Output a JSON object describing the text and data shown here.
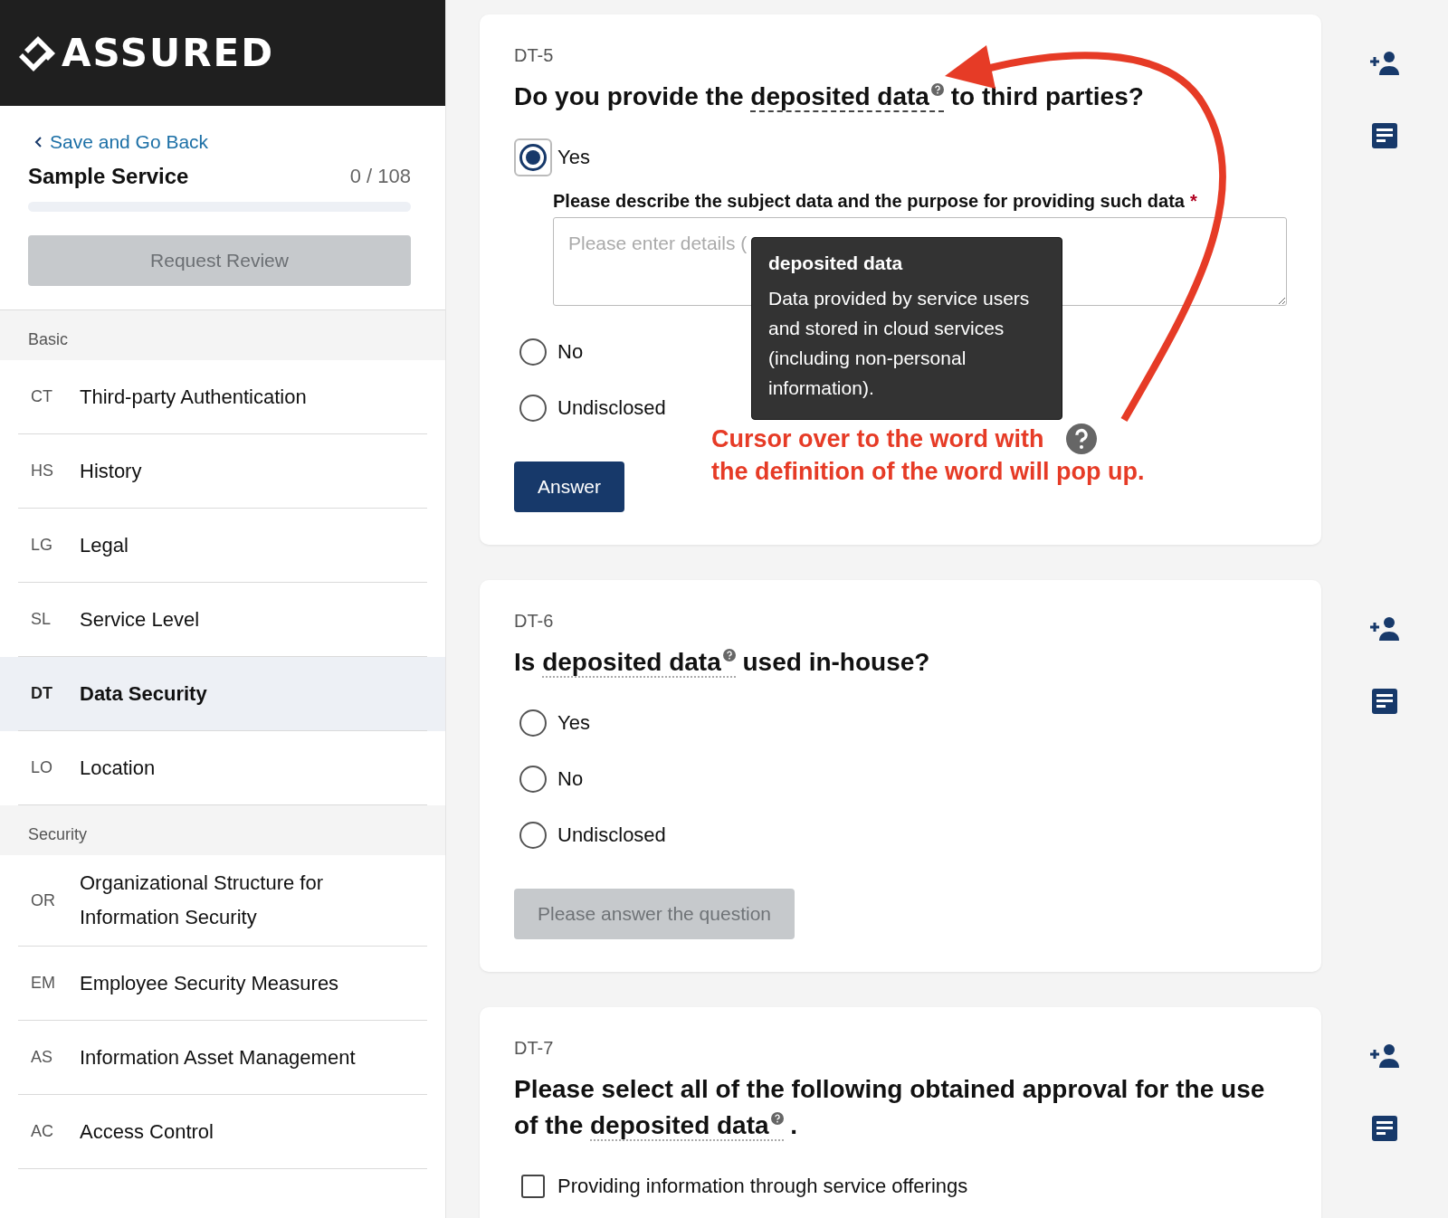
{
  "header": {
    "logo": "ASSURED"
  },
  "sidebar": {
    "back_link": "Save and Go Back",
    "service": "Sample Service",
    "count": "0 / 108",
    "progress": {
      "level": 0
    },
    "review_button": {
      "label": "Request Review",
      "disabled": true
    },
    "sections": [
      {
        "title": "Basic",
        "items": [
          {
            "code": "CT",
            "label": "Third-party Authentication",
            "selected": false
          },
          {
            "code": "HS",
            "label": "History",
            "selected": false
          },
          {
            "code": "LG",
            "label": "Legal",
            "selected": false
          },
          {
            "code": "SL",
            "label": "Service Level",
            "selected": false
          },
          {
            "code": "DT",
            "label": "Data Security",
            "selected": true
          },
          {
            "code": "LO",
            "label": "Location",
            "selected": false
          }
        ]
      },
      {
        "title": "Security",
        "items": [
          {
            "code": "OR",
            "label": "Organizational Structure for Information Security",
            "selected": false
          },
          {
            "code": "EM",
            "label": "Employee Security Measures",
            "selected": false
          },
          {
            "code": "AS",
            "label": "Information Asset Management",
            "selected": false
          },
          {
            "code": "AC",
            "label": "Access Control",
            "selected": false
          }
        ]
      }
    ]
  },
  "questions": [
    {
      "id": "DT-5",
      "parts": [
        {
          "kind": "text",
          "text": "Do you provide the "
        },
        {
          "kind": "term",
          "text": "deposited data",
          "hovered": true
        },
        {
          "kind": "text",
          "text": " to third parties?"
        }
      ],
      "options": [
        {
          "kind": "radio",
          "label": "Yes",
          "selected": true
        },
        {
          "kind": "radio",
          "label": "No",
          "selected": false
        },
        {
          "kind": "radio",
          "label": "Undisclosed",
          "selected": false
        }
      ],
      "detail": {
        "label": "Please describe the subject data and the purpose for providing such data",
        "required": "*",
        "placeholder": "Please enter details ("
      },
      "tooltip": {
        "title": "deposited data",
        "body": "Data provided by service users and stored in cloud services (including non-personal information)."
      },
      "note": {
        "line_1": "Cursor over to the word with",
        "line_2": "the definition of the word will pop up."
      },
      "button": {
        "label": "Answer",
        "disabled": false
      }
    },
    {
      "id": "DT-6",
      "parts": [
        {
          "kind": "text",
          "text": "Is "
        },
        {
          "kind": "term",
          "text": "deposited data",
          "hovered": false
        },
        {
          "kind": "text",
          "text": " used in-house?"
        }
      ],
      "options": [
        {
          "kind": "radio",
          "label": "Yes",
          "selected": false
        },
        {
          "kind": "radio",
          "label": "No",
          "selected": false
        },
        {
          "kind": "radio",
          "label": "Undisclosed",
          "selected": false
        }
      ],
      "button": {
        "label": "Please answer the question",
        "disabled": true
      }
    },
    {
      "id": "DT-7",
      "parts": [
        {
          "kind": "text",
          "text": "Please select all of the following obtained approval for the use of the "
        },
        {
          "kind": "term",
          "text": "deposited data",
          "hovered": false
        },
        {
          "kind": "text",
          "text": " ."
        }
      ],
      "options": [
        {
          "kind": "checkbox",
          "label": "Providing information through service offerings",
          "selected": false
        }
      ]
    }
  ]
}
